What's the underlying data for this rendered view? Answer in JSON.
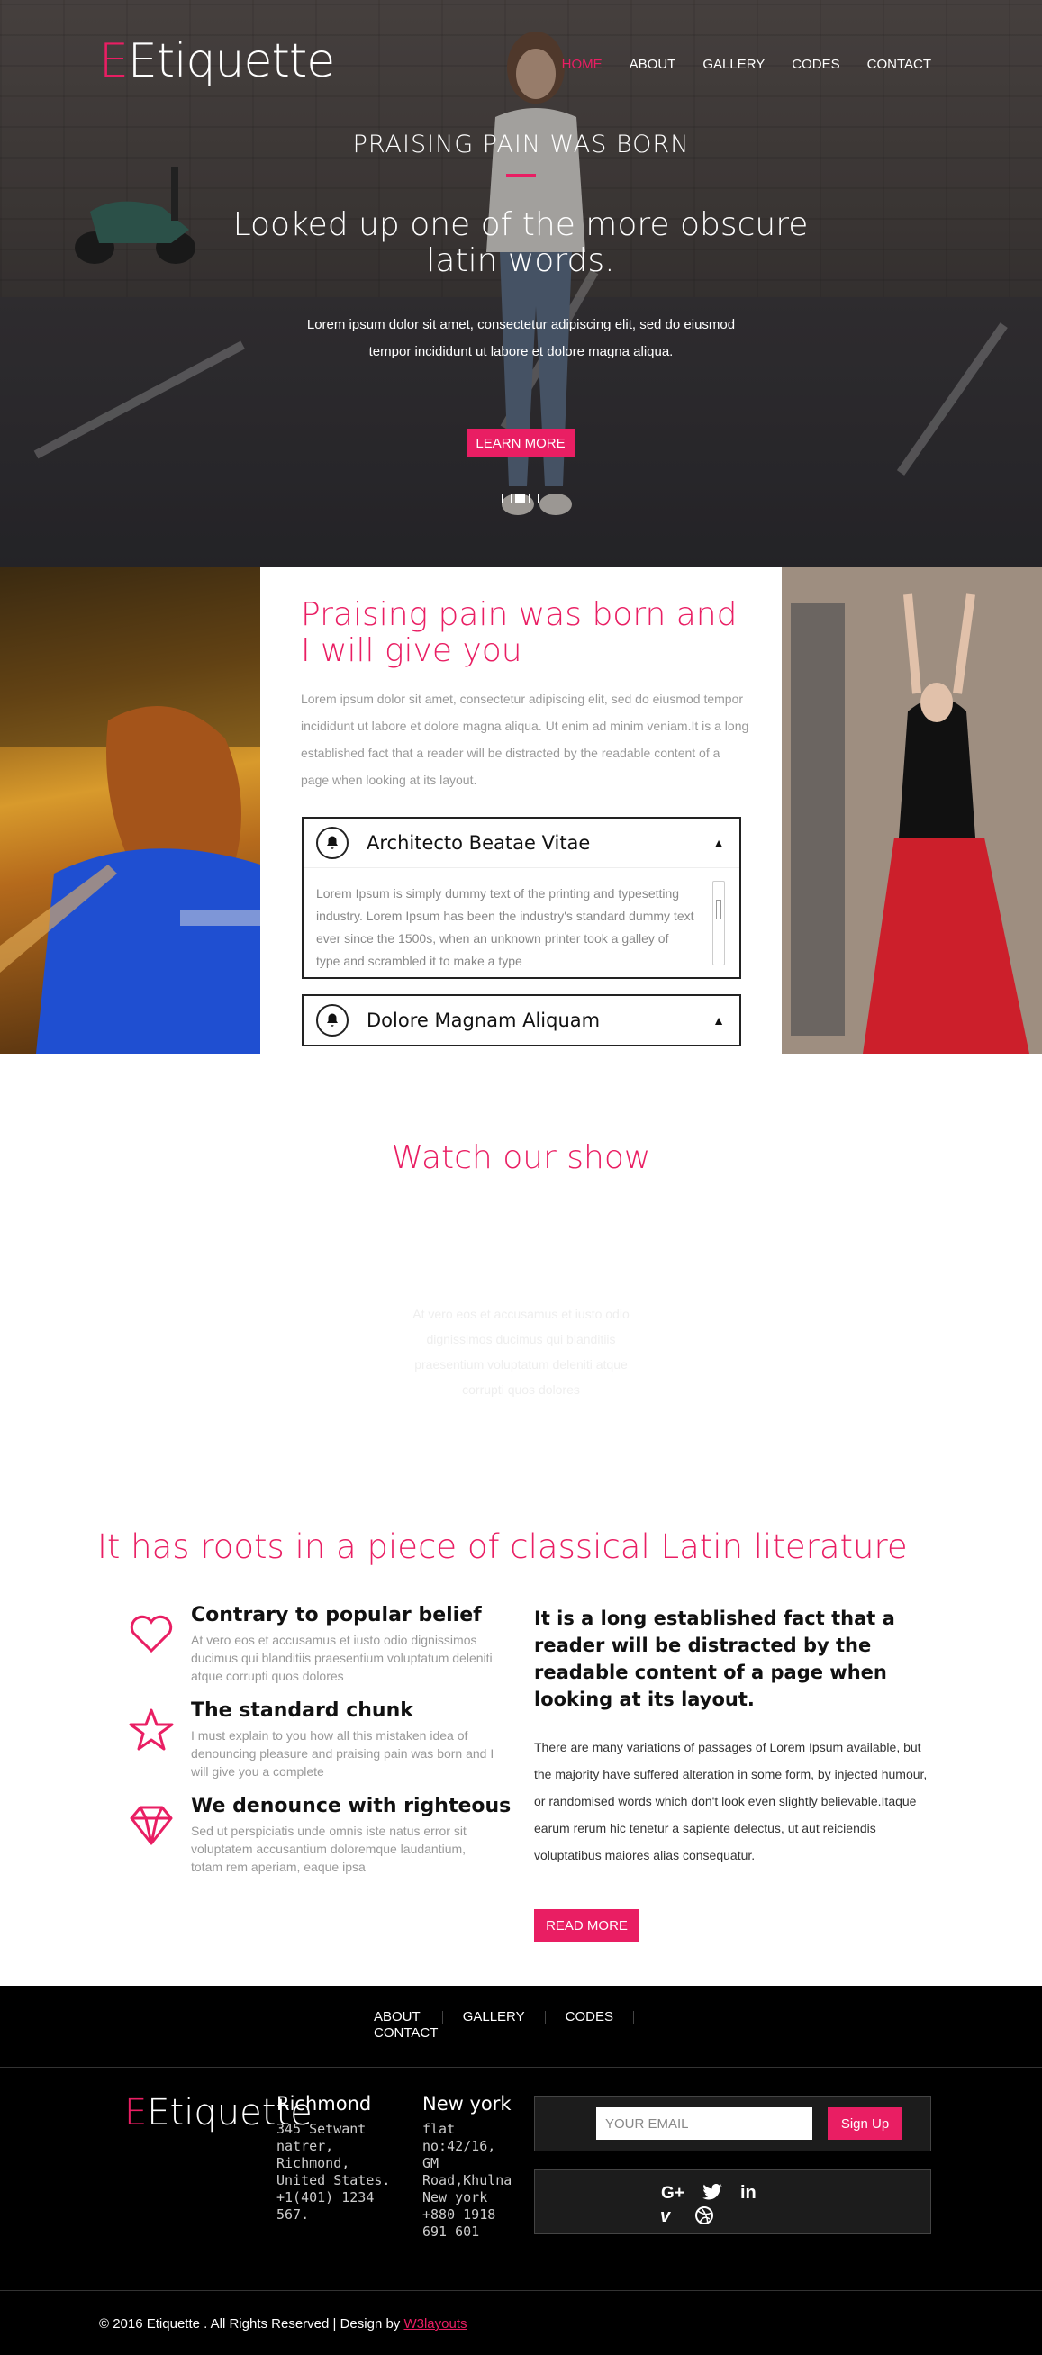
{
  "brand": {
    "logo_e": "E",
    "logo_rest": "Etiquette",
    "accent": "#e91e63"
  },
  "nav": {
    "items": [
      "HOME",
      "ABOUT",
      "GALLERY",
      "CODES",
      "CONTACT"
    ],
    "active": "HOME"
  },
  "hero": {
    "kicker": "PRAISING PAIN WAS BORN",
    "title": "Looked up one of the more obscure latin words.",
    "text": "Lorem ipsum dolor sit amet, consectetur adipiscing elit, sed do eiusmod tempor incididunt ut labore et dolore magna aliqua.",
    "button": "LEARN MORE",
    "slides": 3,
    "active_slide": 2
  },
  "about": {
    "title": "Praising pain was born and I will give you",
    "text": "Lorem ipsum dolor sit amet, consectetur adipiscing elit, sed do eiusmod tempor incididunt ut labore et dolore magna aliqua. Ut enim ad minim veniam.It is a long established fact that a reader will be distracted by the readable content of a page when looking at its layout.",
    "accordion": [
      {
        "label": "Architecto Beatae Vitae",
        "body": "Lorem Ipsum is simply dummy text of the printing and typesetting industry. Lorem Ipsum has been the industry's standard dummy text ever since the 1500s, when an unknown printer took a galley of type and scrambled it to make a type",
        "icon": "bell-icon"
      },
      {
        "label": "Dolore Magnam Aliquam",
        "icon": "bell-icon"
      }
    ]
  },
  "show": {
    "title": "Watch our show",
    "text": "At vero eos et accusamus et iusto odio dignissimos ducimus qui blanditiis praesentium voluptatum deleniti atque corrupti quos dolores"
  },
  "features": {
    "title": "It has roots in a piece of classical Latin literature",
    "items": [
      {
        "title": "Contrary to popular belief",
        "text": "At vero eos et accusamus et iusto odio dignissimos ducimus qui blanditiis praesentium voluptatum deleniti atque corrupti quos dolores",
        "icon": "heart-icon"
      },
      {
        "title": "The standard chunk",
        "text": "I must explain to you how all this mistaken idea of denouncing pleasure and praising pain was born and I will give you a complete",
        "icon": "star-icon"
      },
      {
        "title": "We denounce with righteous",
        "text": "Sed ut perspiciatis unde omnis iste natus error sit voluptatem accusantium doloremque laudantium, totam rem aperiam, eaque ipsa",
        "icon": "diamond-icon"
      }
    ],
    "right_title": "It is a long established fact that a reader will be distracted by the readable content of a page when looking at its layout.",
    "right_text": "There are many variations of passages of Lorem Ipsum available, but the majority have suffered alteration in some form, by injected humour, or randomised words which don't look even slightly believable.Itaque earum rerum hic tenetur a sapiente delectus, ut aut reiciendis voluptatibus maiores alias consequatur.",
    "button": "READ MORE"
  },
  "footer": {
    "nav": [
      "ABOUT",
      "GALLERY",
      "CODES",
      "CONTACT"
    ],
    "logo_e": "E",
    "logo_rest": "Etiquette",
    "address1": {
      "title": "Richmond",
      "lines": [
        "345 Setwant",
        "natrer,",
        "Richmond,",
        "United States.",
        "+1(401) 1234 567."
      ]
    },
    "address2": {
      "title": "New york",
      "lines": [
        "flat",
        "no:42/16,",
        "GM",
        "Road,Khulna",
        "New york",
        "+880 1918",
        "691 601"
      ]
    },
    "email_placeholder": "YOUR EMAIL",
    "signup": "Sign Up",
    "social": [
      "google-plus-icon",
      "twitter-icon",
      "linkedin-icon",
      "vimeo-icon",
      "dribbble-icon"
    ],
    "copyright": "© 2016 Etiquette . All Rights Reserved | Design by",
    "designer": "W3layouts"
  }
}
